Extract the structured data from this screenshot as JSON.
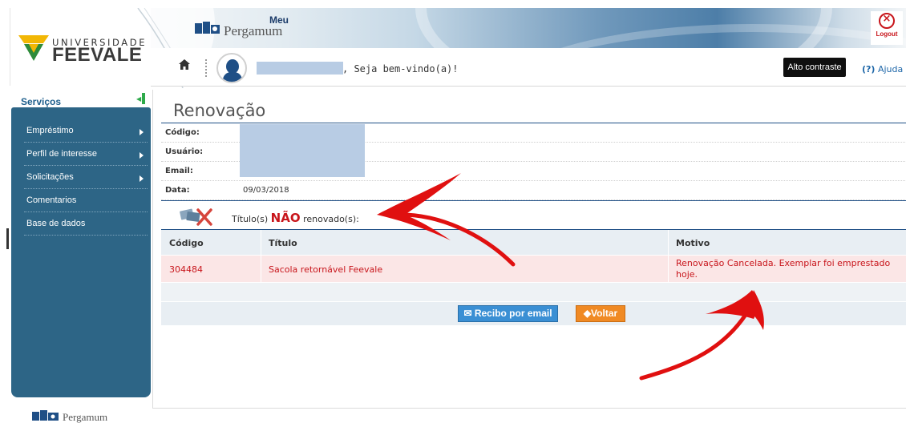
{
  "brand": {
    "university_label": "UNIVERSIDADE",
    "university_name": "FEEVALE",
    "app_prefix": "Meu",
    "app_name": "Pergamum",
    "footer_app_name": "Pergamum"
  },
  "header": {
    "logout_label": "Logout",
    "welcome_text": ", Seja bem-vindo(a)!",
    "contrast_button": "Alto contraste",
    "help_prefix": "(?)",
    "help_label": "Ajuda"
  },
  "sidebar": {
    "title": "Serviços",
    "items": [
      {
        "label": "Empréstimo",
        "has_submenu": true
      },
      {
        "label": "Perfil de interesse",
        "has_submenu": true
      },
      {
        "label": "Solicitações",
        "has_submenu": true
      },
      {
        "label": "Comentarios",
        "has_submenu": false
      },
      {
        "label": "Base de dados",
        "has_submenu": false
      }
    ]
  },
  "main": {
    "title": "Renovação",
    "fields": [
      {
        "label": "Código:",
        "value": ""
      },
      {
        "label": "Usuário:",
        "value": ""
      },
      {
        "label": "Email:",
        "value": ""
      },
      {
        "label": "Data:",
        "value": "09/03/2018"
      }
    ],
    "status": {
      "prefix": "Título(s)",
      "emphasis": "NÃO",
      "suffix": "renovado(s):"
    },
    "table": {
      "headers": [
        "Código",
        "Título",
        "Motivo"
      ],
      "rows": [
        {
          "codigo": "304484",
          "titulo": "Sacola retornável Feevale",
          "motivo_line1": "Renovação Cancelada. Exemplar foi emprestado",
          "motivo_line2": "hoje."
        }
      ]
    },
    "actions": {
      "email_receipt": "Recibo por email",
      "back": "Voltar"
    }
  },
  "colors": {
    "sidebar_bg": "#2d6586",
    "error_red": "#c8151b",
    "row_error_bg": "#fbe6e6",
    "button_blue": "#3a8fd4",
    "button_orange": "#f08a24",
    "rule_blue": "#1f4f86"
  },
  "icons": [
    "home-icon",
    "avatar-icon",
    "logout-icon",
    "renewal-failed-icon",
    "email-icon",
    "back-arrow-icon",
    "submenu-chevron-icon",
    "sidebar-collapse-icon"
  ]
}
